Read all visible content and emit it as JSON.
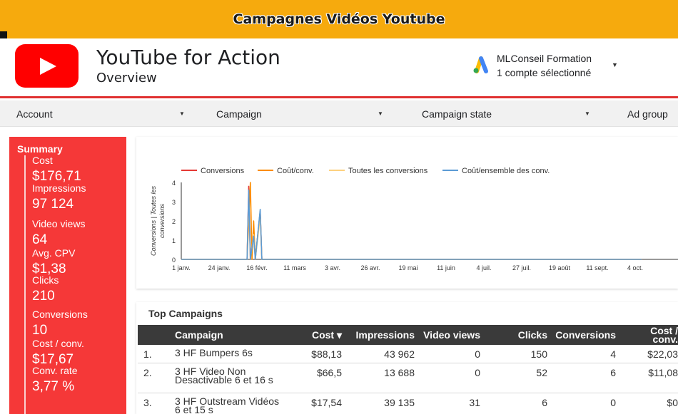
{
  "banner": {
    "title": "Campagnes Vidéos Youtube"
  },
  "header": {
    "title": "YouTube for Action",
    "subtitle": "Overview",
    "account_name": "MLConseil Formation",
    "account_sub": "1 compte sélectionné"
  },
  "filters": [
    {
      "label": "Account"
    },
    {
      "label": "Campaign"
    },
    {
      "label": "Campaign state"
    },
    {
      "label": "Ad group"
    }
  ],
  "summary": {
    "title": "Summary",
    "metrics": [
      {
        "label": "Cost",
        "value": "$176,71"
      },
      {
        "label": "Impressions",
        "value": "97 124"
      },
      {
        "label": "Video views",
        "value": "64"
      },
      {
        "label": "Avg. CPV",
        "value": "$1,38"
      },
      {
        "label": "Clicks",
        "value": "210"
      },
      {
        "label": "Conversions",
        "value": "10"
      },
      {
        "label": "Cost / conv.",
        "value": "$17,67"
      },
      {
        "label": "Conv. rate",
        "value": "3,77 %"
      }
    ]
  },
  "chart_data": {
    "type": "line",
    "title": "",
    "xlabel": "",
    "ylabel": "Conversions | Toutes les conversions",
    "ylim": [
      0,
      4
    ],
    "y_ticks": [
      "0",
      "1",
      "2",
      "3",
      "4"
    ],
    "x_tick_labels": [
      "1 janv.",
      "24 janv.",
      "16 févr.",
      "11 mars",
      "3 avr.",
      "26 avr.",
      "19 mai",
      "11 juin",
      "4 juil.",
      "27 juil.",
      "19 août",
      "11 sept.",
      "4 oct."
    ],
    "legend_position": "top",
    "series": [
      {
        "name": "Conversions",
        "color": "#e53935",
        "points": [
          [
            0,
            0
          ],
          [
            40,
            0
          ],
          [
            41,
            3.8
          ],
          [
            42,
            0
          ],
          [
            44,
            1.5
          ],
          [
            45,
            0
          ],
          [
            48,
            2.5
          ],
          [
            49,
            0
          ],
          [
            280,
            0
          ]
        ]
      },
      {
        "name": "Coût/conv.",
        "color": "#fb8c00",
        "points": [
          [
            0,
            0
          ],
          [
            40,
            0
          ],
          [
            42,
            4
          ],
          [
            43,
            0
          ],
          [
            44,
            2
          ],
          [
            45,
            0
          ],
          [
            48,
            2.5
          ],
          [
            49,
            0
          ],
          [
            280,
            0
          ]
        ]
      },
      {
        "name": "Toutes les conversions",
        "color": "#fdd17f",
        "points": [
          [
            0,
            0
          ],
          [
            40,
            0
          ],
          [
            41,
            3.3
          ],
          [
            42,
            0
          ],
          [
            44,
            1.3
          ],
          [
            45,
            0
          ],
          [
            48,
            2.2
          ],
          [
            49,
            0
          ],
          [
            280,
            0
          ]
        ]
      },
      {
        "name": "Coût/ensemble des conv.",
        "color": "#5b9bd5",
        "points": [
          [
            0,
            0
          ],
          [
            40,
            0
          ],
          [
            41,
            3.6
          ],
          [
            42,
            0
          ],
          [
            44,
            1.2
          ],
          [
            45,
            0
          ],
          [
            48,
            2.6
          ],
          [
            49,
            0
          ],
          [
            280,
            0
          ]
        ]
      }
    ]
  },
  "table": {
    "title": "Top Campaigns",
    "headers": [
      "Campaign",
      "Cost ▾",
      "Impressions",
      "Video views",
      "Clicks",
      "Conversions",
      "Cost / conv."
    ],
    "rows": [
      {
        "num": "1.",
        "campaign": "3 HF Bumpers 6s",
        "cost": "$88,13",
        "impressions": "43 962",
        "video_views": "0",
        "clicks": "150",
        "conversions": "4",
        "cost_conv": "$22,03"
      },
      {
        "num": "2.",
        "campaign": "3 HF Video Non Desactivable 6 et 16 s",
        "cost": "$66,5",
        "impressions": "13 688",
        "video_views": "0",
        "clicks": "52",
        "conversions": "6",
        "cost_conv": "$11,08"
      },
      {
        "num": "3.",
        "campaign": "3 HF Outstream Vidéos 6 et 15 s",
        "cost": "$17,54",
        "impressions": "39 135",
        "video_views": "31",
        "clicks": "6",
        "conversions": "0",
        "cost_conv": "$0"
      }
    ]
  }
}
